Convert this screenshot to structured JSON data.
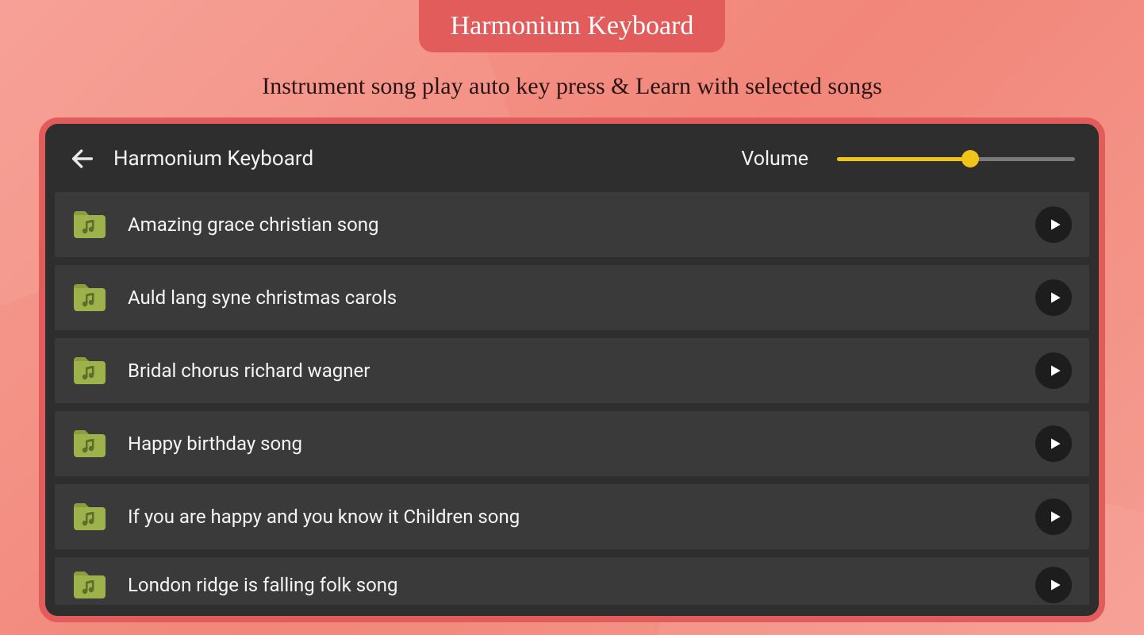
{
  "header": {
    "badge": "Harmonium Keyboard",
    "subtitle": "Instrument song play auto key press & Learn with selected songs"
  },
  "app": {
    "title": "Harmonium Keyboard",
    "volume_label": "Volume",
    "volume_percent": 56
  },
  "songs": [
    {
      "title": "Amazing grace christian song"
    },
    {
      "title": "Auld lang syne christmas carols"
    },
    {
      "title": "Bridal chorus richard wagner"
    },
    {
      "title": "Happy birthday song"
    },
    {
      "title": "If you are happy and you know it Children song"
    },
    {
      "title": "London ridge is falling folk song"
    }
  ],
  "colors": {
    "accent": "#e35c5c",
    "folder": "#9db24a",
    "slider": "#f0c419"
  }
}
